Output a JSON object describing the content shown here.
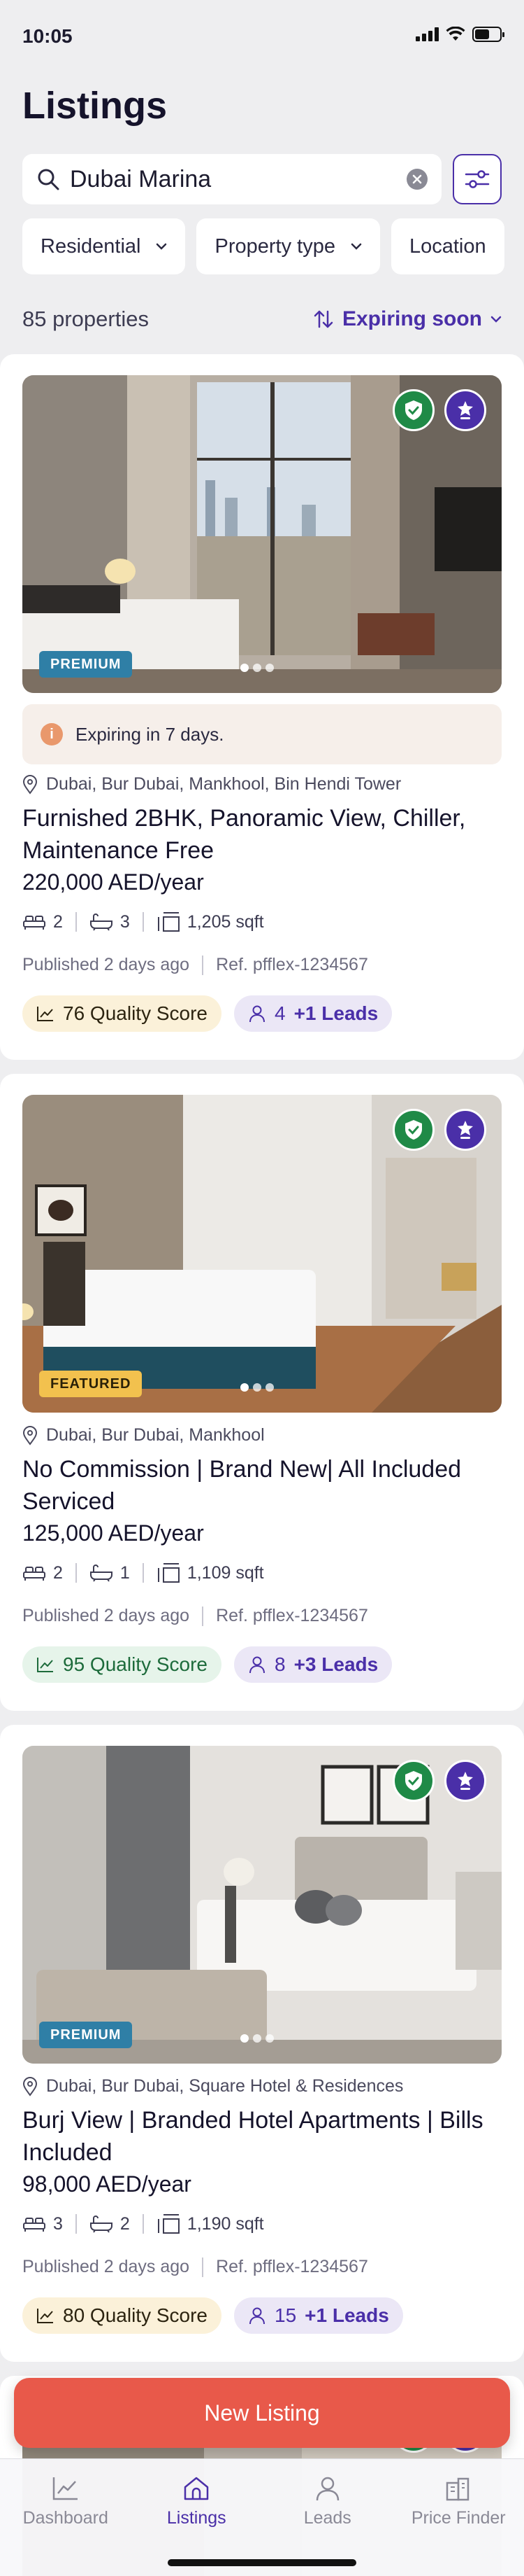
{
  "status": {
    "time": "10:05"
  },
  "header": {
    "title": "Listings"
  },
  "search": {
    "value": "Dubai Marina",
    "placeholder": "Search"
  },
  "filters": [
    {
      "label": "Residential"
    },
    {
      "label": "Property type"
    },
    {
      "label": "Location"
    }
  ],
  "summary": {
    "count": "85 properties",
    "sort": "Expiring soon"
  },
  "listings": [
    {
      "tier": "PREMIUM",
      "expiring": "Expiring in 7 days.",
      "location": "Dubai, Bur Dubai, Mankhool, Bin Hendi Tower",
      "title": "Furnished 2BHK, Panoramic View, Chiller, Maintenance Free",
      "price": "220,000 AED/year",
      "beds": "2",
      "baths": "3",
      "area": "1,205 sqft",
      "published": "Published",
      "published_when": "2 days ago",
      "ref": "Ref. pfflex-1234567",
      "quality": "76 Quality Score",
      "leads_count": "4",
      "leads_extra": "+1 Leads"
    },
    {
      "tier": "FEATURED",
      "location": "Dubai, Bur Dubai, Mankhool",
      "title": "No Commission | Brand New| All Included Serviced",
      "price": "125,000 AED/year",
      "beds": "2",
      "baths": "1",
      "area": "1,109 sqft",
      "published": "Published",
      "published_when": "2 days ago",
      "ref": "Ref. pfflex-1234567",
      "quality": "95 Quality Score",
      "leads_count": "8",
      "leads_extra": "+3 Leads"
    },
    {
      "tier": "PREMIUM",
      "location": "Dubai, Bur Dubai, Square Hotel & Residences",
      "title": "Burj View | Branded Hotel Apartments | Bills Included",
      "price": "98,000 AED/year",
      "beds": "3",
      "baths": "2",
      "area": "1,190 sqft",
      "published": "Published",
      "published_when": "2 days ago",
      "ref": "Ref. pfflex-1234567",
      "quality": "80 Quality Score",
      "leads_count": "15",
      "leads_extra": "+1 Leads"
    }
  ],
  "actions": {
    "new_listing": "New Listing"
  },
  "tabs": [
    {
      "label": "Dashboard"
    },
    {
      "label": "Listings"
    },
    {
      "label": "Leads"
    },
    {
      "label": "Price Finder"
    }
  ],
  "colors": {
    "accent": "#4a2fa8",
    "cta": "#e8594a",
    "verified": "#1f8a47",
    "premium": "#2f7fa6",
    "featured": "#f2c14e"
  }
}
